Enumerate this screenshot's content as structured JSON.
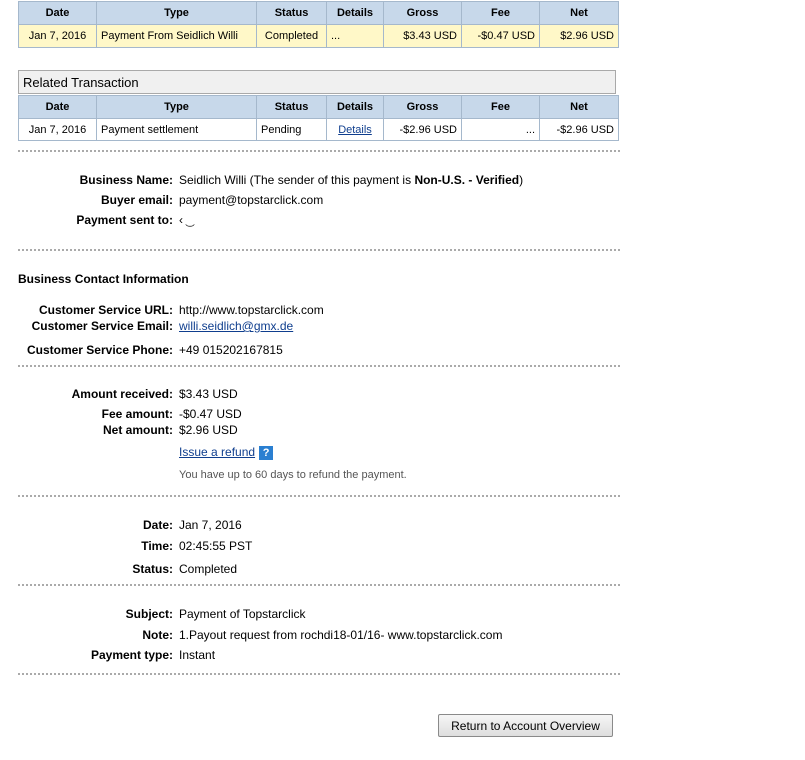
{
  "main_table": {
    "headers": [
      "Date",
      "Type",
      "Status",
      "Details",
      "Gross",
      "Fee",
      "Net"
    ],
    "row": {
      "date": "Jan 7, 2016",
      "type": "Payment From Seidlich Willi",
      "status": "Completed",
      "details": "...",
      "gross": "$3.43 USD",
      "fee": "-$0.47 USD",
      "net": "$2.96 USD"
    }
  },
  "related": {
    "title": "Related Transaction",
    "headers": [
      "Date",
      "Type",
      "Status",
      "Details",
      "Gross",
      "Fee",
      "Net"
    ],
    "row": {
      "date": "Jan 7, 2016",
      "type": "Payment settlement",
      "status": "Pending",
      "details": "Details",
      "gross": "-$2.96 USD",
      "fee": "...",
      "net": "-$2.96 USD"
    }
  },
  "business": {
    "name_label": "Business Name:",
    "name_value": "Seidlich Willi (The sender of this payment is ",
    "name_status": "Non-U.S. - Verified",
    "name_close": ")",
    "email_label": "Buyer email:",
    "email_value": "payment@topstarclick.com",
    "sent_to_label": "Payment sent to:",
    "sent_to_value": "‹               ͜"
  },
  "contact": {
    "heading": "Business Contact Information",
    "url_label": "Customer Service URL:",
    "url_value": "http://www.topstarclick.com",
    "email_label": "Customer Service Email:",
    "email_value": "willi.seidlich@gmx.de",
    "phone_label": "Customer Service Phone:",
    "phone_value": "+49 015202167815"
  },
  "amounts": {
    "received_label": "Amount received:",
    "received_value": "$3.43 USD",
    "fee_label": "Fee amount:",
    "fee_value": "-$0.47 USD",
    "net_label": "Net amount:",
    "net_value": "$2.96 USD",
    "refund_link": "Issue a refund",
    "help_icon": "?",
    "refund_note": "You have up to 60 days to refund the payment."
  },
  "timing": {
    "date_label": "Date:",
    "date_value": "Jan 7, 2016",
    "time_label": "Time:",
    "time_value": "02:45:55 PST",
    "status_label": "Status:",
    "status_value": "Completed"
  },
  "details": {
    "subject_label": "Subject:",
    "subject_value": "Payment of Topstarclick",
    "note_label": "Note:",
    "note_value": "1.Payout request from rochdi18-01/16- www.topstarclick.com",
    "ptype_label": "Payment type:",
    "ptype_value": "Instant"
  },
  "footer": {
    "return_button": "Return to Account Overview"
  },
  "colors": {
    "header_bg": "#c7d8ea",
    "highlight_row": "#fff8c8",
    "link": "#0f3e8e",
    "help_icon_bg": "#2a7fd1"
  }
}
